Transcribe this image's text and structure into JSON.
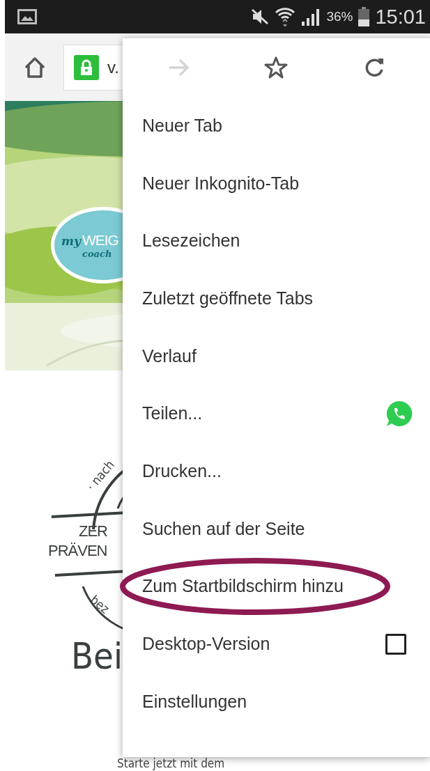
{
  "status_bar": {
    "battery": "36%",
    "time": "15:01"
  },
  "toolbar": {
    "url": "v."
  },
  "page": {
    "logo": {
      "prefix": "my",
      "word": "WEIG",
      "sub": "coach"
    },
    "stamp": {
      "top": "· nach",
      "line1": "ZER",
      "line2": "PRÄVEN",
      "bottom": "bez"
    },
    "heading": "Bei",
    "subheading": "Starte jetzt mit dem"
  },
  "menu": {
    "actions": [
      {
        "kind": "forward",
        "disabled": true
      },
      {
        "kind": "bookmark",
        "disabled": false
      },
      {
        "kind": "reload",
        "disabled": false
      }
    ],
    "items": [
      {
        "label": "Neuer Tab",
        "kind": "plain",
        "highlighted": false
      },
      {
        "label": "Neuer Inkognito-Tab",
        "kind": "plain",
        "highlighted": false
      },
      {
        "label": "Lesezeichen",
        "kind": "plain",
        "highlighted": false
      },
      {
        "label": "Zuletzt geöffnete Tabs",
        "kind": "plain",
        "highlighted": false
      },
      {
        "label": "Verlauf",
        "kind": "plain",
        "highlighted": false
      },
      {
        "label": "Teilen...",
        "kind": "share",
        "highlighted": false
      },
      {
        "label": "Drucken...",
        "kind": "plain",
        "highlighted": false
      },
      {
        "label": "Suchen auf der Seite",
        "kind": "plain",
        "highlighted": false
      },
      {
        "label": "Zum Startbildschirm hinzu",
        "kind": "plain",
        "highlighted": true
      },
      {
        "label": "Desktop-Version",
        "kind": "checkbox",
        "checked": false,
        "highlighted": false
      },
      {
        "label": "Einstellungen",
        "kind": "plain",
        "highlighted": false
      }
    ]
  }
}
